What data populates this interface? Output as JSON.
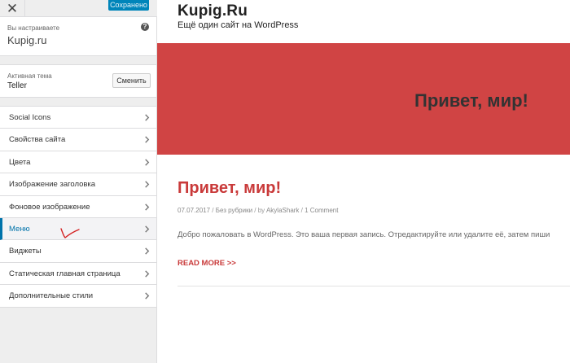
{
  "topbar": {
    "close_glyph": "✕",
    "save_label": "Сохранено"
  },
  "info": {
    "label": "Вы настраиваете",
    "title": "Kupig.ru",
    "help_glyph": "?"
  },
  "theme": {
    "label": "Активная тема",
    "name": "Teller",
    "change_label": "Сменить"
  },
  "menu": {
    "items": [
      {
        "label": "Social Icons"
      },
      {
        "label": "Свойства сайта"
      },
      {
        "label": "Цвета"
      },
      {
        "label": "Изображение заголовка"
      },
      {
        "label": "Фоновое изображение"
      },
      {
        "label": "Меню"
      },
      {
        "label": "Виджеты"
      },
      {
        "label": "Статическая главная страница"
      },
      {
        "label": "Дополнительные стили"
      }
    ],
    "active_index": 5
  },
  "preview": {
    "site_title": "Kupig.Ru",
    "tagline": "Ещё один сайт на WordPress",
    "hero_title": "Привет, мир!",
    "post": {
      "title": "Привет, мир!",
      "date": "07.07.2017",
      "sep1": " / ",
      "category": "Без рубрики",
      "sep2": " / by ",
      "author": "AkylaShark",
      "sep3": " / ",
      "comments": "1 Comment",
      "excerpt": "Добро пожаловать в WordPress. Это ваша первая запись. Отредактируйте или удалите её, затем пиши",
      "read_more": "READ MORE >>"
    }
  },
  "colors": {
    "accent": "#0073aa",
    "save_button": "#0085ba",
    "hero": "#d04444",
    "post_title": "#c93a3a",
    "annotation": "#d42020"
  },
  "icons": [
    "close-icon",
    "help-icon",
    "chevron-right-icon",
    "handwritten-check-mark"
  ]
}
